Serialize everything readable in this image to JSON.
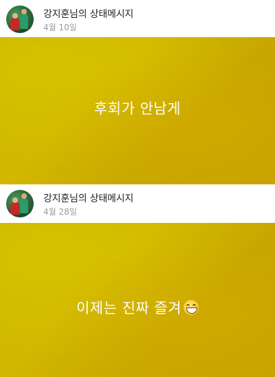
{
  "posts": [
    {
      "author": "강지훈님의 상태메시지",
      "date": "4월 10일",
      "message": "후회가 안남게",
      "emoji": ""
    },
    {
      "author": "강지훈님의 상태메시지",
      "date": "4월 28일",
      "message": "이제는 진짜 즐겨",
      "emoji": "grinning-face-emoji"
    }
  ],
  "colors": {
    "background_yellow": "#c9b700",
    "message_text": "#ffffff",
    "date_text": "#9a9a9a"
  }
}
